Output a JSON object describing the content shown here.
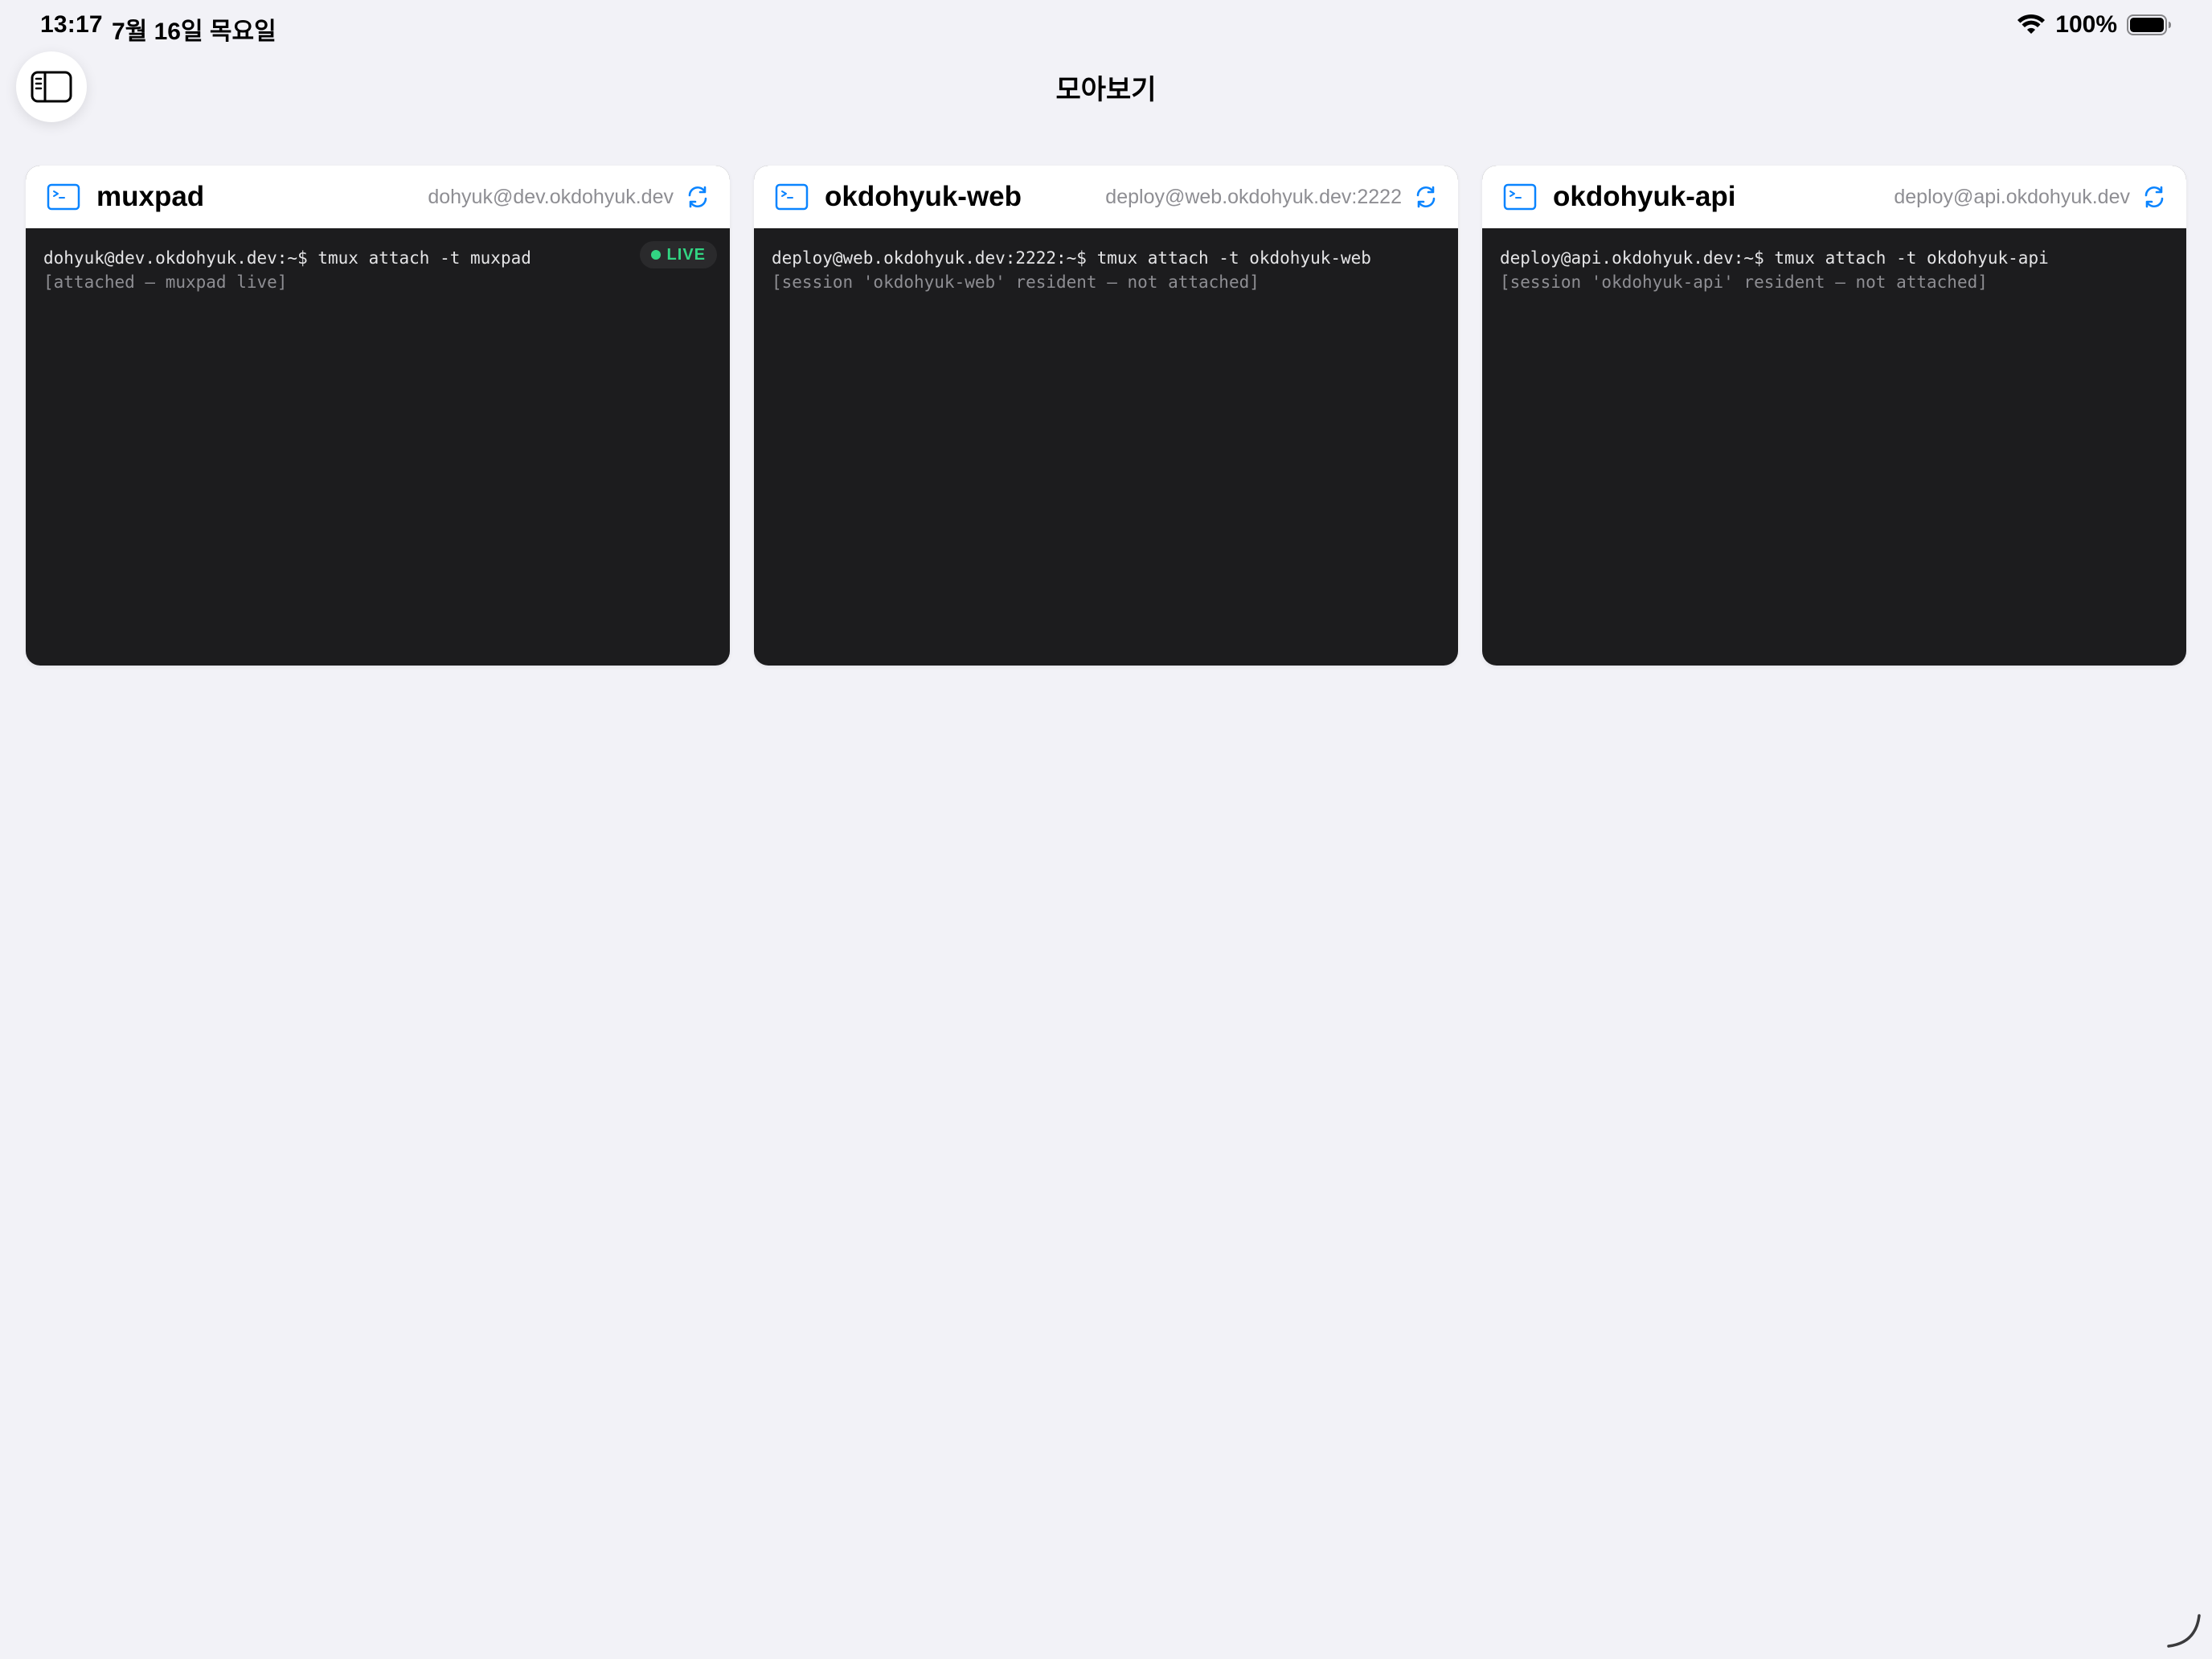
{
  "status_bar": {
    "time": "13:17",
    "date": "7월 16일 목요일",
    "battery": "100%"
  },
  "nav": {
    "title": "모아보기"
  },
  "colors": {
    "accent": "#0a84ff",
    "terminal_bg": "#1c1c1e",
    "live": "#32d583",
    "background": "#f2f2f7"
  },
  "sessions": [
    {
      "name": "muxpad",
      "host": "dohyuk@dev.okdohyuk.dev",
      "command": "dohyuk@dev.okdohyuk.dev:~$ tmux attach -t muxpad",
      "status": "[attached — muxpad live]",
      "badge": "LIVE"
    },
    {
      "name": "okdohyuk-web",
      "host": "deploy@web.okdohyuk.dev:2222",
      "command": "deploy@web.okdohyuk.dev:2222:~$ tmux attach -t okdohyuk-web",
      "status": "[session 'okdohyuk-web' resident — not attached]"
    },
    {
      "name": "okdohyuk-api",
      "host": "deploy@api.okdohyuk.dev",
      "command": "deploy@api.okdohyuk.dev:~$ tmux attach -t okdohyuk-api",
      "status": "[session 'okdohyuk-api' resident — not attached]"
    }
  ],
  "icons": {
    "sidebar": "sidebar-left-icon",
    "terminal": "terminal-icon",
    "refresh": "refresh-icon",
    "wifi": "wifi-icon",
    "battery": "battery-icon"
  }
}
